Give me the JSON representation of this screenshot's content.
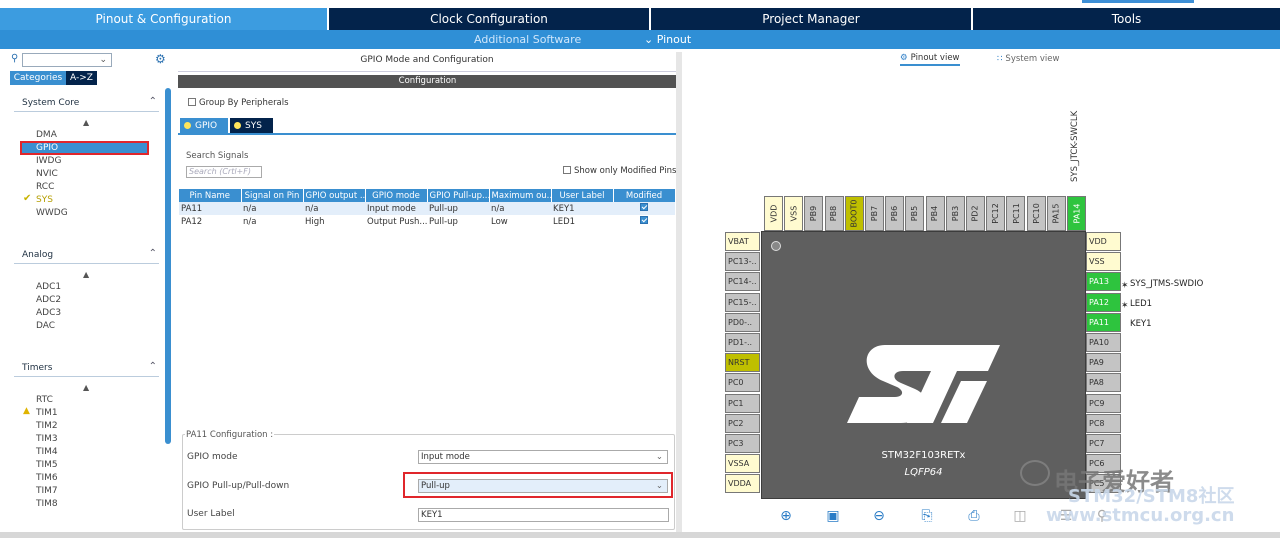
{
  "nav": {
    "tabs": [
      {
        "label": "Pinout & Configuration"
      },
      {
        "label": "Clock Configuration"
      },
      {
        "label": "Project Manager"
      },
      {
        "label": "Tools"
      }
    ],
    "sub_additional": "Additional Software",
    "sub_pinout": "⌄ Pinout"
  },
  "left": {
    "search_placeholder": "",
    "tab_categories": "Categories",
    "tab_az": "A->Z",
    "sections": [
      {
        "title": "System Core",
        "items": [
          "DMA",
          "GPIO",
          "IWDG",
          "NVIC",
          "RCC",
          "SYS",
          "WWDG"
        ]
      },
      {
        "title": "Analog",
        "items": [
          "ADC1",
          "ADC2",
          "ADC3",
          "DAC"
        ]
      },
      {
        "title": "Timers",
        "items": [
          "RTC",
          "TIM1",
          "TIM2",
          "TIM3",
          "TIM4",
          "TIM5",
          "TIM6",
          "TIM7",
          "TIM8"
        ]
      }
    ]
  },
  "middle": {
    "title": "GPIO Mode and Configuration",
    "config_bar": "Configuration",
    "group_by": "Group By Peripherals",
    "tab_gpio": "GPIO",
    "tab_sys": "SYS",
    "search_label": "Search Signals",
    "search_placeholder": "Search (Crtl+F)",
    "show_modified": "Show only Modified Pins",
    "table": {
      "headers": [
        "Pin Name",
        "Signal on Pin",
        "GPIO output ...",
        "GPIO mode",
        "GPIO Pull-up...",
        "Maximum ou...",
        "User Label",
        "Modified"
      ],
      "rows": [
        [
          "PA11",
          "n/a",
          "n/a",
          "Input mode",
          "Pull-up",
          "n/a",
          "KEY1"
        ],
        [
          "PA12",
          "n/a",
          "High",
          "Output Push...",
          "Pull-up",
          "Low",
          "LED1"
        ]
      ]
    },
    "pa_config": {
      "legend": "PA11 Configuration :",
      "gpio_mode_label": "GPIO mode",
      "gpio_mode_value": "Input mode",
      "pull_label": "GPIO Pull-up/Pull-down",
      "pull_value": "Pull-up",
      "user_label_label": "User Label",
      "user_label_value": "KEY1"
    }
  },
  "right": {
    "pinout_view": "Pinout view",
    "system_view": "System view",
    "top_signal": "SYS_JTCK-SWCLK",
    "top_pins": [
      "VDD",
      "VSS",
      "PB9",
      "PB8",
      "BOOT0",
      "PB7",
      "PB6",
      "PB5",
      "PB4",
      "PB3",
      "PD2",
      "PC12",
      "PC11",
      "PC10",
      "PA15",
      "PA14"
    ],
    "left_pins": [
      "VBAT",
      "PC13-..",
      "PC14-..",
      "PC15-..",
      "PD0-..",
      "PD1-..",
      "NRST",
      "PC0",
      "PC1",
      "PC2",
      "PC3",
      "VSSA",
      "VDDA"
    ],
    "right_pins": [
      "VDD",
      "VSS",
      "PA13",
      "PA12",
      "PA11",
      "PA10",
      "PA9",
      "PA8",
      "PC9",
      "PC8",
      "PC7",
      "PC6",
      "PC5"
    ],
    "signals": [
      "SYS_JTMS-SWDIO",
      "LED1",
      "KEY1"
    ],
    "chip_name": "STM32F103RETx",
    "chip_package": "LQFP64",
    "logo": "ST"
  },
  "watermark": {
    "line1": "电子爱好者",
    "line2": "STM32/STM8社区",
    "line3": "www.stmcu.org.cn"
  }
}
